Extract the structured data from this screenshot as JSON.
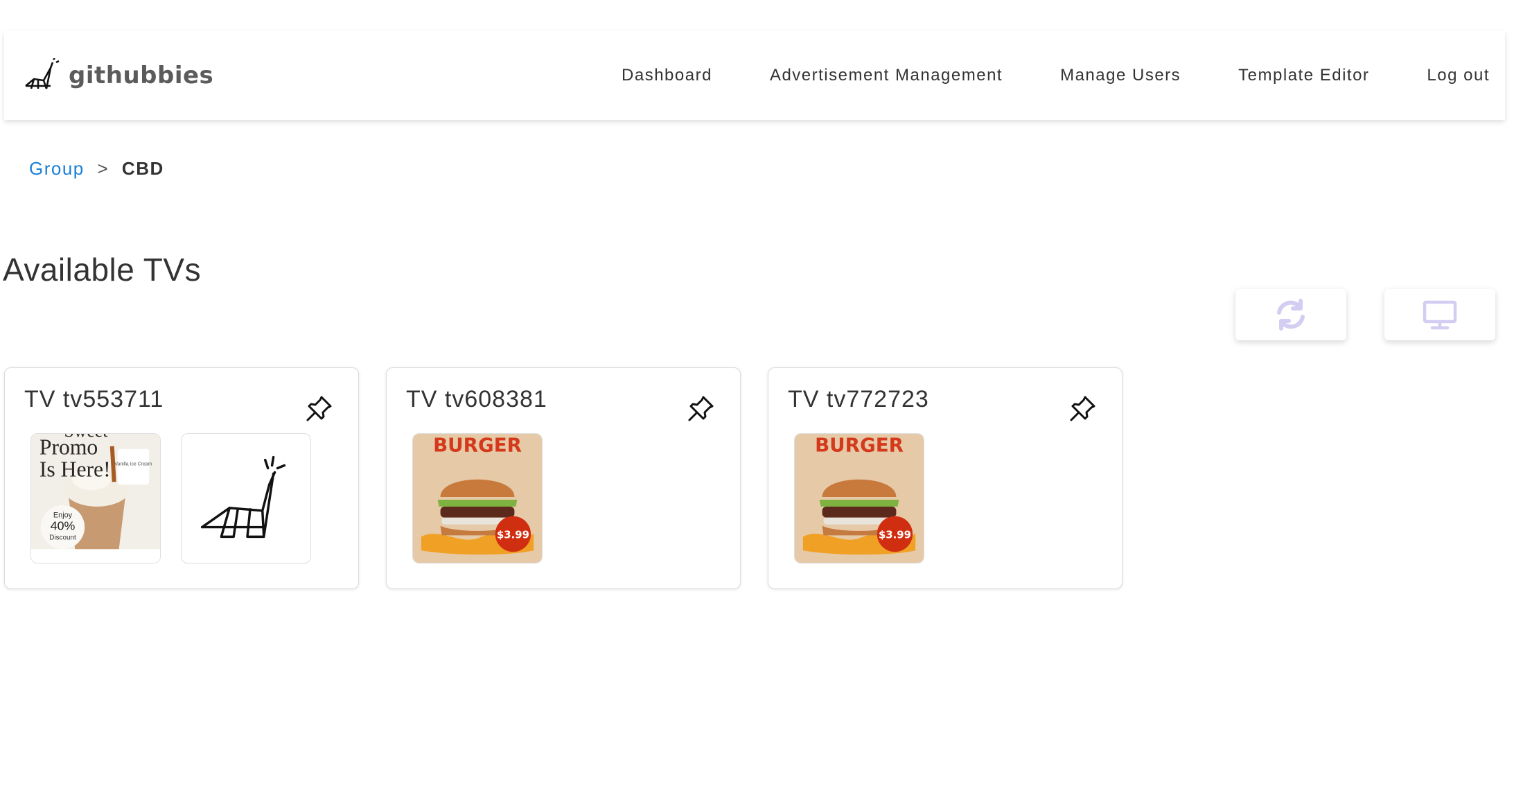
{
  "brand": {
    "name": "githubbies",
    "logo_icon": "dino-logo-icon"
  },
  "nav": {
    "links": [
      "Dashboard",
      "Advertisement Management",
      "Manage Users",
      "Template Editor",
      "Log out"
    ]
  },
  "breadcrumb": {
    "parent": "Group",
    "separator": ">",
    "current": "CBD"
  },
  "page": {
    "title": "Available TVs"
  },
  "toolbar": {
    "refresh_icon": "refresh-icon",
    "display_icon": "monitor-icon",
    "icon_color": "#d4cdf2"
  },
  "tvs": [
    {
      "title": "TV tv553711",
      "pin_icon": "pin-icon",
      "ads": [
        {
          "type": "promo",
          "headline_top": "Sweet",
          "headline_1": "Promo",
          "headline_2": "Is Here!",
          "side_text": "Vanilla Ice Cream",
          "badge_1": "Enjoy",
          "badge_2": "40%",
          "badge_3": "Discount"
        },
        {
          "type": "logo",
          "icon": "dino-icon"
        }
      ]
    },
    {
      "title": "TV tv608381",
      "pin_icon": "pin-icon",
      "ads": [
        {
          "type": "burger",
          "label": "BURGER",
          "price": "$3.99"
        }
      ]
    },
    {
      "title": "TV tv772723",
      "pin_icon": "pin-icon",
      "ads": [
        {
          "type": "burger",
          "label": "BURGER",
          "price": "$3.99"
        }
      ]
    }
  ]
}
